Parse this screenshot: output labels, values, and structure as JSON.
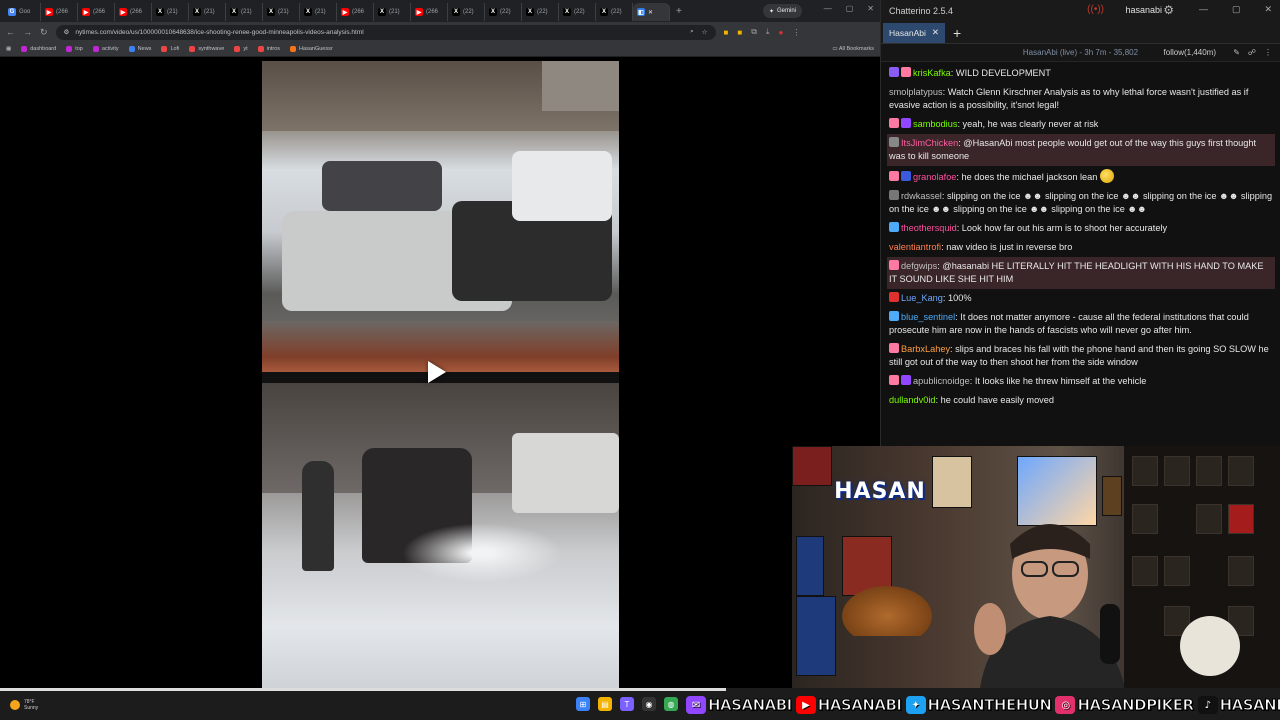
{
  "browser": {
    "tabs": [
      {
        "label": "Goo",
        "color": "#4285f4",
        "glyph": "G"
      },
      {
        "label": "(266",
        "color": "#ff0000",
        "glyph": "▶"
      },
      {
        "label": "(266",
        "color": "#ff0000",
        "glyph": "▶"
      },
      {
        "label": "(266",
        "color": "#ff0000",
        "glyph": "▶"
      },
      {
        "label": "(21)",
        "color": "#000000",
        "glyph": "X"
      },
      {
        "label": "(21)",
        "color": "#000000",
        "glyph": "X"
      },
      {
        "label": "(21)",
        "color": "#000000",
        "glyph": "X"
      },
      {
        "label": "(21)",
        "color": "#000000",
        "glyph": "X"
      },
      {
        "label": "(21)",
        "color": "#000000",
        "glyph": "X"
      },
      {
        "label": "(266",
        "color": "#ff0000",
        "glyph": "▶"
      },
      {
        "label": "(21)",
        "color": "#000000",
        "glyph": "X"
      },
      {
        "label": "(266",
        "color": "#ff0000",
        "glyph": "▶"
      },
      {
        "label": "(22)",
        "color": "#000000",
        "glyph": "X"
      },
      {
        "label": "(22)",
        "color": "#000000",
        "glyph": "X"
      },
      {
        "label": "(22)",
        "color": "#000000",
        "glyph": "X"
      },
      {
        "label": "(22)",
        "color": "#000000",
        "glyph": "X"
      },
      {
        "label": "(22)",
        "color": "#000000",
        "glyph": "X"
      }
    ],
    "gemini_label": "Gemini",
    "url": "nytimes.com/video/us/100000010648638/ice-shooting-renee-good-minneapolis-videos-analysis.html",
    "bookmarks": [
      {
        "label": "dashboard",
        "color": "#c026d3"
      },
      {
        "label": "top",
        "color": "#c026d3"
      },
      {
        "label": "activity",
        "color": "#c026d3"
      },
      {
        "label": "News",
        "color": "#3b82f6"
      },
      {
        "label": "Lofi",
        "color": "#ef4444"
      },
      {
        "label": "synthwave",
        "color": "#ef4444"
      },
      {
        "label": "yt",
        "color": "#ef4444"
      },
      {
        "label": "intros",
        "color": "#ef4444"
      },
      {
        "label": "HasanGuessr",
        "color": "#f97316"
      }
    ],
    "all_bookmarks_label": "All Bookmarks"
  },
  "video": {
    "progress": 1.0
  },
  "chatterino": {
    "title": "Chatterino 2.5.4",
    "account": "hasanabi",
    "tab_label": "HasanAbi",
    "channel_status": "HasanAbi (live) - 3h 7m - 35,802",
    "follow_label": "follow(1,440m)",
    "messages": [
      {
        "user": "krisKafka",
        "color": "#7cfc00",
        "text": "WILD DEVELOPMENT",
        "badges": [
          "#8a5cf6",
          "#ff7aa2"
        ],
        "hl": false
      },
      {
        "user": "smolplatypus",
        "color": "#bfbfbf",
        "text": "Watch Glenn Kirschner Analysis as to why lethal force wasn't justified as if evasive action is a possibility, it'snot legal!",
        "badges": [],
        "hl": false
      },
      {
        "user": "sambodius",
        "color": "#7cfc00",
        "text": "yeah, he was clearly never at risk",
        "badges": [
          "#ff7aa2",
          "#9147ff"
        ],
        "hl": false
      },
      {
        "user": "ItsJimChicken",
        "color": "#ff5fa2",
        "text": "@HasanAbi most people would get out of the way this guys first thought was to kill someone",
        "badges": [
          "#888888"
        ],
        "hl": true
      },
      {
        "user": "granolafoe",
        "color": "#ff4fa0",
        "text": "he does the michael jackson lean",
        "badges": [
          "#ff7aa2",
          "#3b5bdb"
        ],
        "hl": false,
        "emote": true
      },
      {
        "user": "rdwkassel",
        "color": "#bfbfbf",
        "text": "slipping on the ice ☻☻ slipping on the ice ☻☻ slipping on the ice ☻☻ slipping on the ice ☻☻ slipping on the ice ☻☻ slipping on the ice ☻☻",
        "badges": [
          "#777777"
        ],
        "hl": false
      },
      {
        "user": "theothersquid",
        "color": "#ff4fa0",
        "text": "Look how far out his arm is to shoot her accurately",
        "badges": [
          "#4dabf7"
        ],
        "hl": false
      },
      {
        "user": "valentiantrofi",
        "color": "#ff7f50",
        "text": "naw video is just in reverse bro",
        "badges": [],
        "hl": false
      },
      {
        "user": "defgwips",
        "color": "#bfbfbf",
        "text": "@hasanabi HE LITERALLY HIT THE HEADLIGHT WITH HIS HAND TO MAKE IT SOUND LIKE SHE HIT HIM",
        "badges": [
          "#ff7aa2"
        ],
        "hl": true
      },
      {
        "user": "Lue_Kang",
        "color": "#6ea8fe",
        "text": "100%",
        "badges": [
          "#e03131"
        ],
        "hl": false
      },
      {
        "user": "blue_sentinel",
        "color": "#4dabf7",
        "text": "It does not matter anymore - cause all the federal institutions that could prosecute him are now in the hands of fascists who will never go after him.",
        "badges": [
          "#4dabf7"
        ],
        "hl": false
      },
      {
        "user": "BarbxLahey",
        "color": "#ff9f43",
        "text": "slips and braces his fall with the phone hand and then its going SO SLOW he still got out of the way to then shoot her from the side window",
        "badges": [
          "#ff7aa2"
        ],
        "hl": false
      },
      {
        "user": "apublicnoidge",
        "color": "#bfbfbf",
        "text": "It looks like he threw himself at the vehicle",
        "badges": [
          "#ff7aa2",
          "#9147ff"
        ],
        "hl": false
      },
      {
        "user": "dullandv0id",
        "color": "#7cfc00",
        "text": "he could have easily moved",
        "badges": [],
        "hl": false
      }
    ]
  },
  "webcam": {
    "logo_text": "HASAN"
  },
  "socials": [
    {
      "handle": "HASANABI",
      "color": "#9147ff",
      "glyph": "✉"
    },
    {
      "handle": "HASANABI",
      "color": "#ff0000",
      "glyph": "▶"
    },
    {
      "handle": "HASANTHEHUN",
      "color": "#1da1f2",
      "glyph": "✦"
    },
    {
      "handle": "HASANDPIKER",
      "color": "#e1306c",
      "glyph": "◎"
    },
    {
      "handle": "HASANDPIKER",
      "color": "#111111",
      "glyph": "♪"
    }
  ],
  "taskbar": {
    "weather_temp": "78°F",
    "weather_desc": "Sunny",
    "apps": [
      {
        "name": "windows-start",
        "color": "#3b82f6",
        "glyph": "⊞"
      },
      {
        "name": "file-explorer",
        "color": "#f5b301",
        "glyph": "▤"
      },
      {
        "name": "teams",
        "color": "#7b61ff",
        "glyph": "T"
      },
      {
        "name": "obs",
        "color": "#333333",
        "glyph": "◉"
      },
      {
        "name": "chrome",
        "color": "#34a853",
        "glyph": "◍"
      },
      {
        "name": "chatterino",
        "color": "#2d7be5",
        "glyph": "C"
      }
    ]
  }
}
